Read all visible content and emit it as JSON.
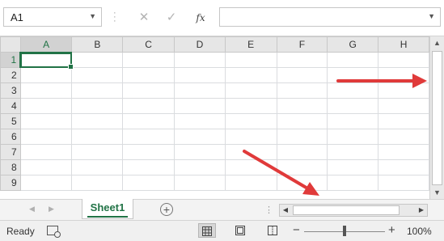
{
  "formula_bar": {
    "name_box_value": "A1",
    "cancel_glyph": "✕",
    "enter_glyph": "✓",
    "function_label": "fx",
    "formula_value": ""
  },
  "grid": {
    "columns": [
      "A",
      "B",
      "C",
      "D",
      "E",
      "F",
      "G",
      "H"
    ],
    "rows": [
      "1",
      "2",
      "3",
      "4",
      "5",
      "6",
      "7",
      "8",
      "9"
    ],
    "selected_cell": "A1"
  },
  "sheets": {
    "tabs": [
      {
        "label": "Sheet1",
        "active": true
      }
    ],
    "add_sheet_glyph": "+"
  },
  "status_bar": {
    "status": "Ready",
    "zoom_minus": "−",
    "zoom_plus": "+",
    "zoom_level": "100%",
    "views": [
      "normal-view",
      "page-layout-view",
      "page-break-preview"
    ]
  },
  "annotations": {
    "arrow_color": "#e03a3a",
    "arrows": [
      "arrow-to-vertical-scrollbar",
      "arrow-to-horizontal-scrollbar"
    ]
  },
  "colors": {
    "accent": "#217346",
    "header_bg": "#e6e6e6",
    "gridline": "#dadcdf"
  }
}
